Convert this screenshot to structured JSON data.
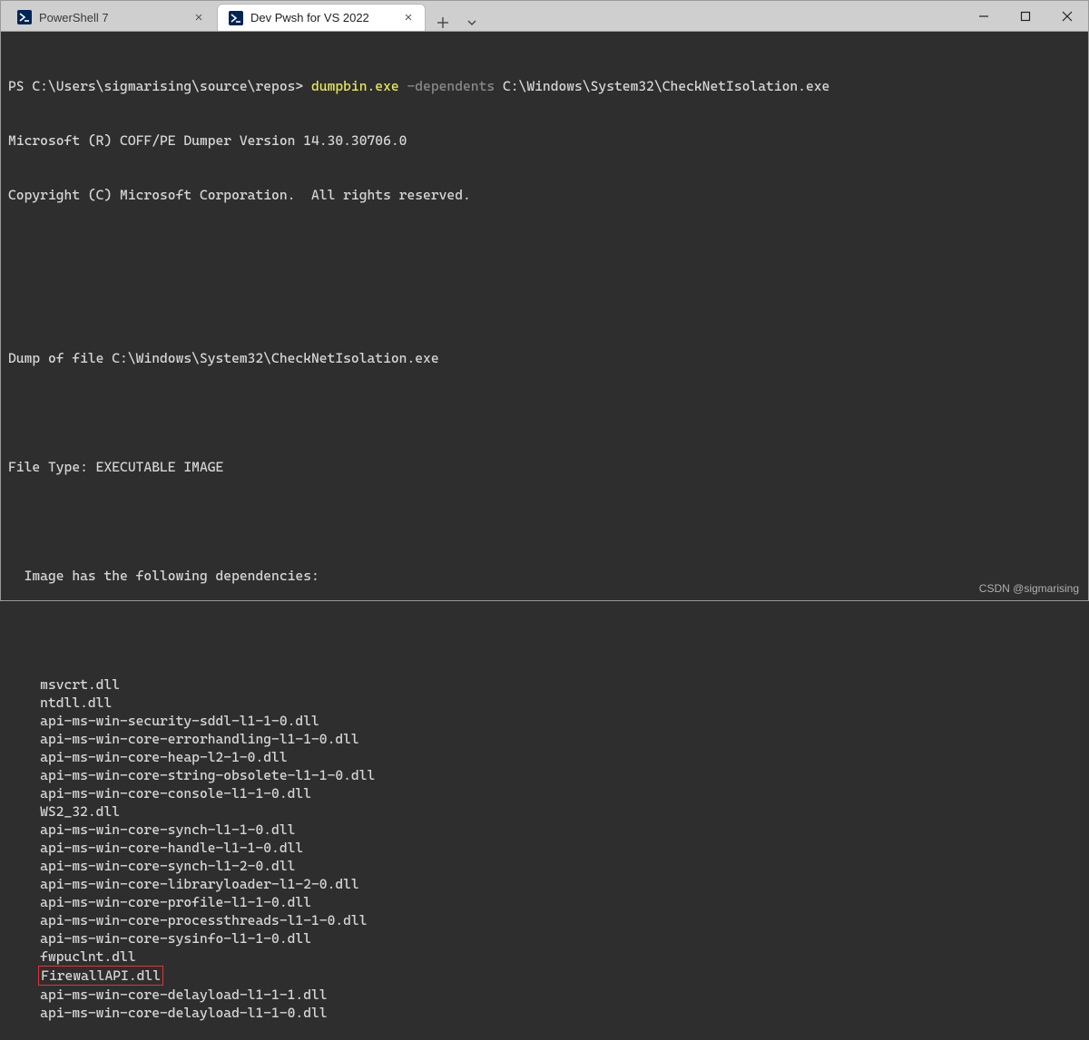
{
  "tabs": [
    {
      "label": "PowerShell 7",
      "active": false,
      "icon": "powershell-icon"
    },
    {
      "label": "Dev Pwsh for VS 2022",
      "active": true,
      "icon": "powershell-icon"
    }
  ],
  "prompt_prefix": "PS C:\\Users\\sigmarising\\source\\repos> ",
  "command": {
    "exe": "dumpbin.exe",
    "flag": "-dependents",
    "arg": "C:\\Windows\\System32\\CheckNetIsolation.exe"
  },
  "header_lines": [
    "Microsoft (R) COFF/PE Dumper Version 14.30.30706.0",
    "Copyright (C) Microsoft Corporation.  All rights reserved."
  ],
  "dump_of_file": "Dump of file C:\\Windows\\System32\\CheckNetIsolation.exe",
  "file_type": "File Type: EXECUTABLE IMAGE",
  "deps_heading": "Image has the following dependencies:",
  "dependencies": [
    "msvcrt.dll",
    "ntdll.dll",
    "api-ms-win-security-sddl-l1-1-0.dll",
    "api-ms-win-core-errorhandling-l1-1-0.dll",
    "api-ms-win-core-heap-l2-1-0.dll",
    "api-ms-win-core-string-obsolete-l1-1-0.dll",
    "api-ms-win-core-console-l1-1-0.dll",
    "WS2_32.dll",
    "api-ms-win-core-synch-l1-1-0.dll",
    "api-ms-win-core-handle-l1-1-0.dll",
    "api-ms-win-core-synch-l1-2-0.dll",
    "api-ms-win-core-libraryloader-l1-2-0.dll",
    "api-ms-win-core-profile-l1-1-0.dll",
    "api-ms-win-core-processthreads-l1-1-0.dll",
    "api-ms-win-core-sysinfo-l1-1-0.dll",
    "fwpuclnt.dll",
    "FirewallAPI.dll",
    "api-ms-win-core-delayload-l1-1-1.dll",
    "api-ms-win-core-delayload-l1-1-0.dll"
  ],
  "highlighted_dependency": "FirewallAPI.dll",
  "watermark": "CSDN @sigmarising"
}
